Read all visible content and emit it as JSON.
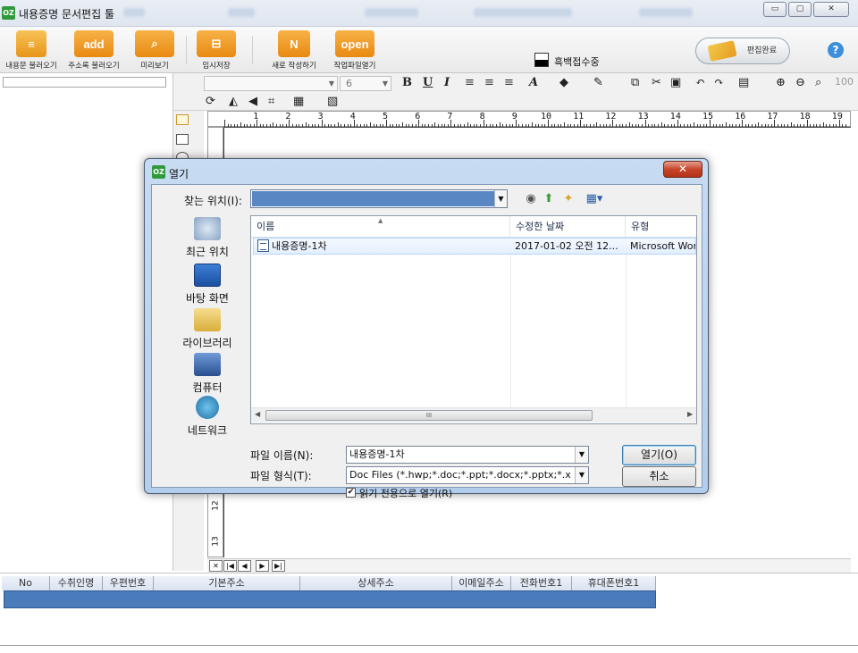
{
  "app": {
    "title": "내용증명 문서편집 툴",
    "logo_text": "OZ"
  },
  "toolbar": {
    "buttons": [
      {
        "label": "내용문 불러오기",
        "icon": "document-load-icon"
      },
      {
        "label": "주소록 불러오기",
        "icon_text": "add"
      },
      {
        "label": "미리보기",
        "icon": "preview-icon"
      },
      {
        "label": "임시저장",
        "icon": "save-icon"
      },
      {
        "label": "새로 작성하기",
        "icon": "new-doc-icon"
      },
      {
        "label": "작업파일열기",
        "icon_text": "open"
      }
    ],
    "bw_print_label": "흑백접수중",
    "edit_done_label": "편집완료",
    "help_label": "?"
  },
  "format_bar": {
    "font_size": "6",
    "bold": "B",
    "underline": "U",
    "italic": "I",
    "zoom": "100"
  },
  "ruler": {
    "h_numbers": [
      "1",
      "2",
      "3",
      "4",
      "5",
      "6",
      "7",
      "8",
      "9",
      "10",
      "11",
      "12",
      "13",
      "14",
      "15",
      "16",
      "17",
      "18",
      "19"
    ],
    "v_numbers": [
      "12",
      "13"
    ]
  },
  "pagenav": [
    "✕",
    "|◀",
    "◀",
    "▶",
    "▶|"
  ],
  "address_table": {
    "columns": [
      "No",
      "수취인명",
      "우편번호",
      "기본주소",
      "상세주소",
      "이메일주소",
      "전화번호1",
      "휴대폰번호1"
    ]
  },
  "dialog": {
    "title": "열기",
    "logo_text": "OZ",
    "close_label": "✕",
    "look_in_label": "찾는 위치(I):",
    "look_in_value": "",
    "places": [
      {
        "label": "최근 위치",
        "icon": "recent-places-icon"
      },
      {
        "label": "바탕 화면",
        "icon": "desktop-icon"
      },
      {
        "label": "라이브러리",
        "icon": "library-icon"
      },
      {
        "label": "컴퓨터",
        "icon": "computer-icon"
      },
      {
        "label": "네트워크",
        "icon": "network-icon"
      }
    ],
    "columns": [
      "이름",
      "수정한 날짜",
      "유형"
    ],
    "files": [
      {
        "name": "내용증명-1차",
        "modified": "2017-01-02 오전 12...",
        "type": "Microsoft Wor"
      }
    ],
    "file_name_label": "파일 이름(N):",
    "file_name_value": "내용증명-1차",
    "file_type_label": "파일 형식(T):",
    "file_type_value": "Doc Files (*.hwp;*.doc;*.ppt;*.docx;*.pptx;*.x",
    "readonly_label": "읽기 전용으로 열기(R)",
    "readonly_checked": "✔",
    "open_button": "열기(O)",
    "cancel_button": "취소",
    "scroll_grip": "III"
  }
}
